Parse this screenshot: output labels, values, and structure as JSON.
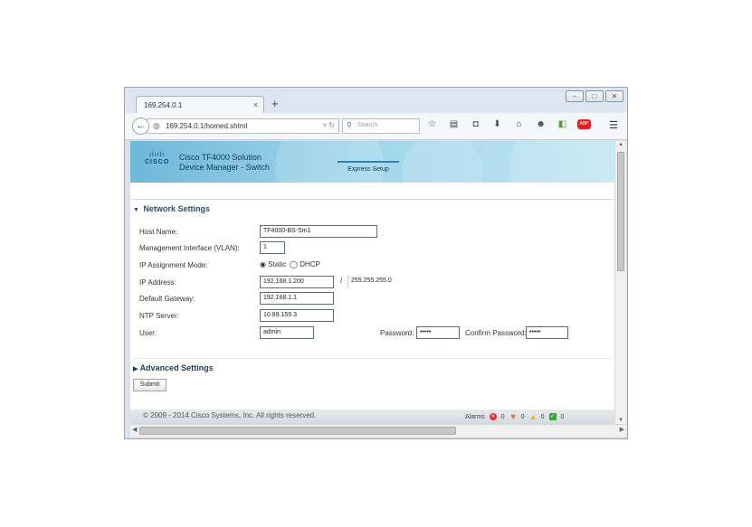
{
  "browser": {
    "tab_title": "169.254.0.1",
    "tab_close": "×",
    "new_tab": "+",
    "url": "169.254.0.1/homed.shtml",
    "search_placeholder": "Search",
    "window_buttons": [
      "–",
      "□",
      "✕"
    ]
  },
  "banner": {
    "logo_bars": "ılıılı",
    "logo_word": "CISCO",
    "product_line1": "Cisco TF4000 Solution",
    "product_line2": "Device Manager - Switch",
    "active_tab": "Express Setup"
  },
  "network": {
    "title": "Network Settings",
    "host_name_label": "Host Name:",
    "host_name_value": "TF4000-BS-Sm1",
    "vlan_label": "Management Interface (VLAN):",
    "vlan_value": "1",
    "ip_mode_label": "IP Assignment Mode:",
    "ip_mode_static": "Static",
    "ip_mode_dhcp": "DHCP",
    "ip_address_label": "IP Address:",
    "ip_address_value": "192.168.1.200",
    "slash": "/",
    "subnet_value": "255.255.255.0",
    "gateway_label": "Default Gateway:",
    "gateway_value": "192.168.1.1",
    "ntp_label": "NTP Server:",
    "ntp_value": "10.89.159.3",
    "user_label": "User:",
    "user_value": "admin",
    "password_label": "Password:",
    "password_value": "•••••",
    "confirm_label": "Confirm Password:",
    "confirm_value": "•••••"
  },
  "advanced": {
    "title": "Advanced Settings"
  },
  "submit_label": "Submit",
  "footer": {
    "copyright": "© 2009 - 2014 Cisco Systems, Inc. All rights reserved.",
    "alarms_label": "Alarms",
    "critical_count": "0",
    "major_count": "0",
    "minor_count": "0",
    "ok_count": "0"
  },
  "colors": {
    "banner": "#6fb8d8",
    "critical": "#d9342b",
    "major": "#e8731c",
    "minor": "#f0b400",
    "ok": "#3aa63a"
  }
}
